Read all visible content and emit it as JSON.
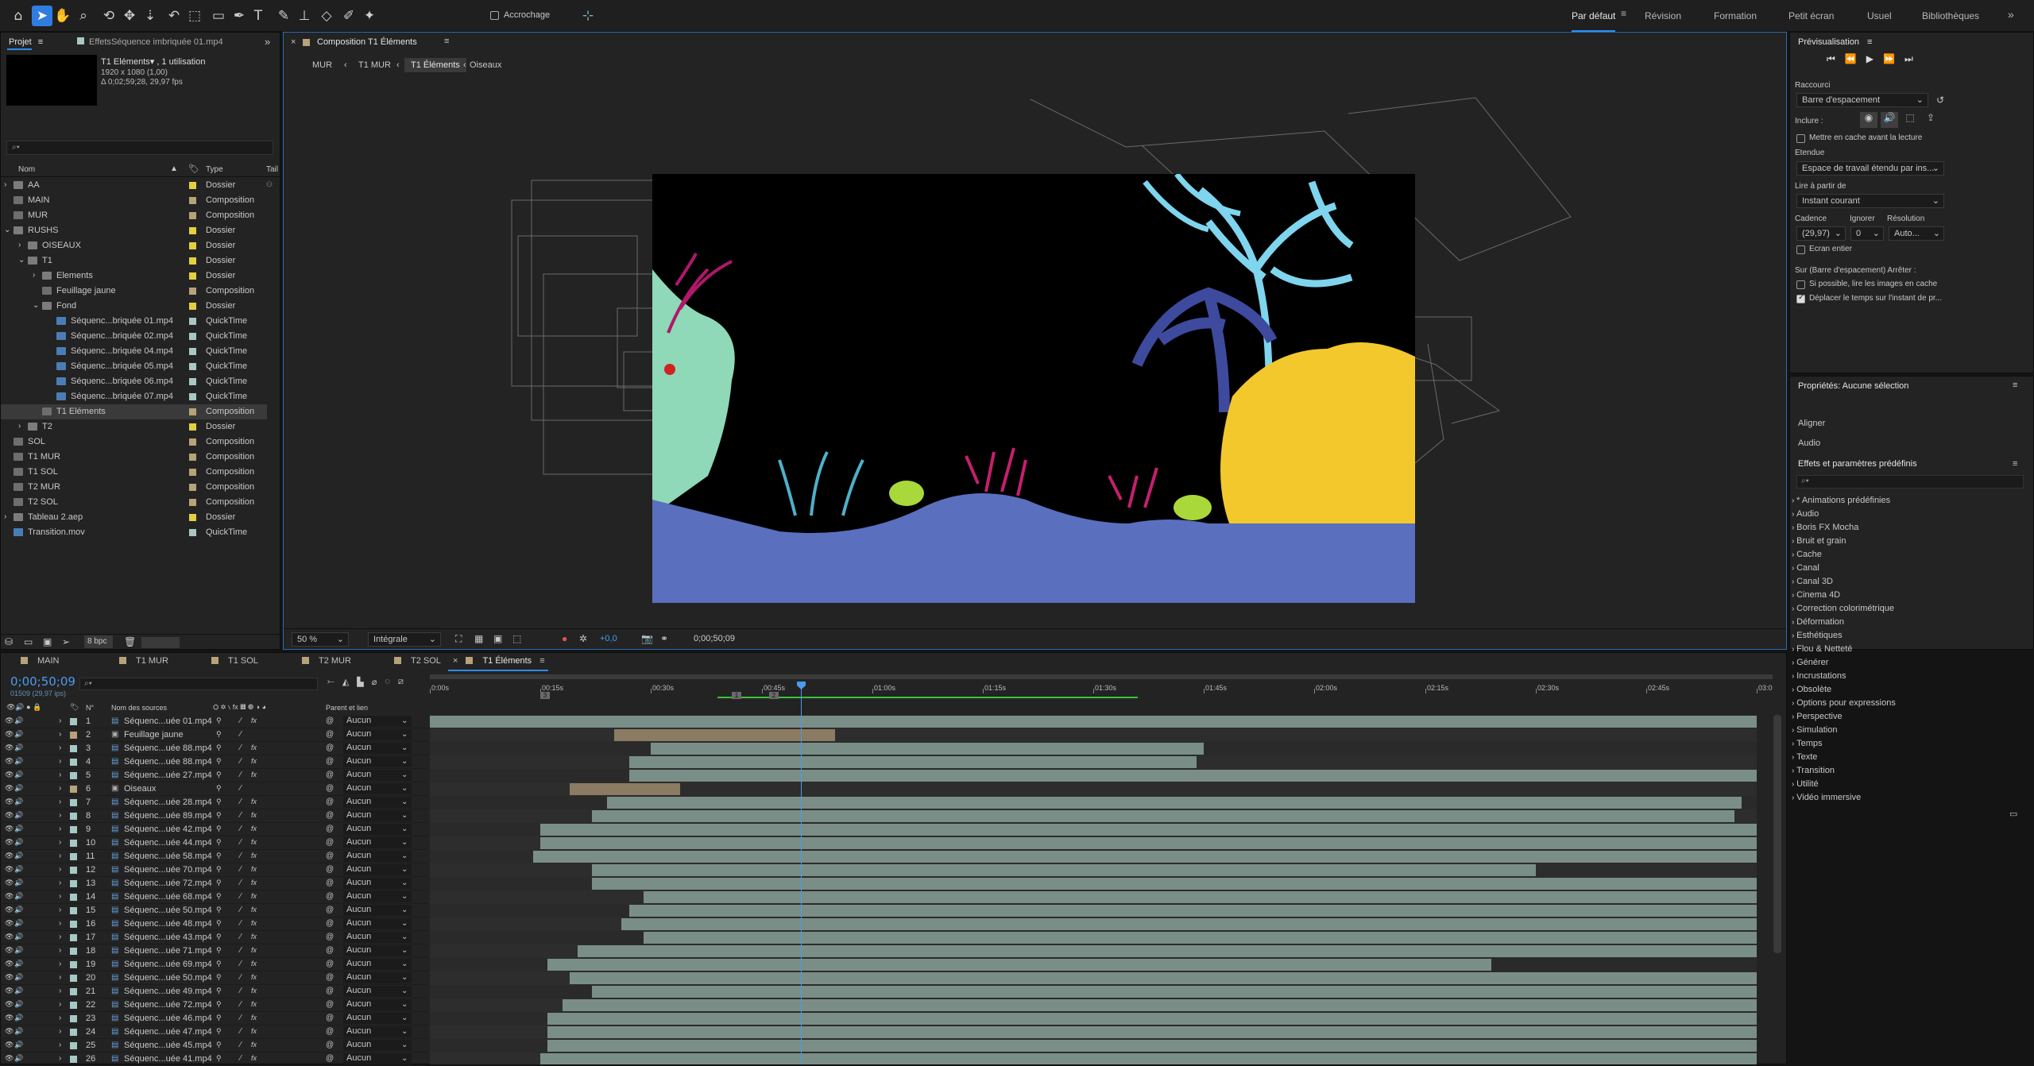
{
  "toolbar": {
    "tools": [
      {
        "name": "home-icon",
        "g": "⌂"
      },
      {
        "name": "selection-tool-icon",
        "g": "➤"
      },
      {
        "name": "hand-tool-icon",
        "g": "✋"
      },
      {
        "name": "zoom-tool-icon",
        "g": "⌕"
      },
      {
        "name": "orbit-camera-icon",
        "g": "⟲"
      },
      {
        "name": "pan-camera-icon",
        "g": "✥"
      },
      {
        "name": "dolly-camera-icon",
        "g": "⇣"
      },
      {
        "name": "rotation-tool-icon",
        "g": "↶"
      },
      {
        "name": "pan-behind-icon",
        "g": "⬚"
      },
      {
        "name": "rectangle-tool-icon",
        "g": "▭"
      },
      {
        "name": "pen-tool-icon",
        "g": "✒"
      },
      {
        "name": "type-tool-icon",
        "g": "T"
      },
      {
        "name": "brush-tool-icon",
        "g": "✎"
      },
      {
        "name": "clone-stamp-icon",
        "g": "⊥"
      },
      {
        "name": "eraser-tool-icon",
        "g": "◇"
      },
      {
        "name": "roto-brush-icon",
        "g": "✐"
      },
      {
        "name": "puppet-tool-icon",
        "g": "✦"
      }
    ],
    "snap_label": "Accrochage",
    "workspaces": [
      "Par défaut",
      "Révision",
      "Formation",
      "Petit écran",
      "Usuel",
      "Bibliothèques"
    ],
    "more": "»"
  },
  "project": {
    "tab": "Projet",
    "tab2_prefix": "Effets",
    "tab2": "Séquence imbriquée 01.mp4",
    "info_name": "T1 Eléments▾ , 1 utilisation",
    "info_res": "1920 x 1080 (1,00)",
    "info_dur": "Δ 0;02;59;28, 29,97 fps",
    "search_placeholder": "⌕▾",
    "col_name": "Nom",
    "col_type": "Type",
    "col_tail": "Tail",
    "rows": [
      {
        "n": "AA",
        "t": "Dossier",
        "c": "#e4cf3e",
        "k": "folder",
        "d": 0,
        "a": "›"
      },
      {
        "n": "MAIN",
        "t": "Composition",
        "c": "#b7a27a",
        "k": "comp",
        "d": 0,
        "a": ""
      },
      {
        "n": "MUR",
        "t": "Composition",
        "c": "#b7a27a",
        "k": "comp",
        "d": 0,
        "a": ""
      },
      {
        "n": "RUSHS",
        "t": "Dossier",
        "c": "#e4cf3e",
        "k": "folder",
        "d": 0,
        "a": "⌄"
      },
      {
        "n": "OISEAUX",
        "t": "Dossier",
        "c": "#e4cf3e",
        "k": "folder",
        "d": 1,
        "a": "›"
      },
      {
        "n": "T1",
        "t": "Dossier",
        "c": "#e4cf3e",
        "k": "folder",
        "d": 1,
        "a": "⌄"
      },
      {
        "n": "Elements",
        "t": "Dossier",
        "c": "#e4cf3e",
        "k": "folder",
        "d": 2,
        "a": "›"
      },
      {
        "n": "Feuillage jaune",
        "t": "Composition",
        "c": "#b7a27a",
        "k": "comp",
        "d": 2,
        "a": ""
      },
      {
        "n": "Fond",
        "t": "Dossier",
        "c": "#e4cf3e",
        "k": "folder",
        "d": 2,
        "a": "⌄"
      },
      {
        "n": "Séquenc...briquée 01.mp4",
        "t": "QuickTime",
        "c": "#a7c8c4",
        "k": "file",
        "d": 3,
        "a": ""
      },
      {
        "n": "Séquenc...briquée 02.mp4",
        "t": "QuickTime",
        "c": "#a7c8c4",
        "k": "file",
        "d": 3,
        "a": ""
      },
      {
        "n": "Séquenc...briquée 04.mp4",
        "t": "QuickTime",
        "c": "#a7c8c4",
        "k": "file",
        "d": 3,
        "a": ""
      },
      {
        "n": "Séquenc...briquée 05.mp4",
        "t": "QuickTime",
        "c": "#a7c8c4",
        "k": "file",
        "d": 3,
        "a": ""
      },
      {
        "n": "Séquenc...briquée 06.mp4",
        "t": "QuickTime",
        "c": "#a7c8c4",
        "k": "file",
        "d": 3,
        "a": ""
      },
      {
        "n": "Séquenc...briquée 07.mp4",
        "t": "QuickTime",
        "c": "#a7c8c4",
        "k": "file",
        "d": 3,
        "a": ""
      },
      {
        "n": "T1 Eléments",
        "t": "Composition",
        "c": "#b7a27a",
        "k": "comp",
        "d": 2,
        "a": "",
        "hl": true
      },
      {
        "n": "T2",
        "t": "Dossier",
        "c": "#e4cf3e",
        "k": "folder",
        "d": 1,
        "a": "›"
      },
      {
        "n": "SOL",
        "t": "Composition",
        "c": "#b7a27a",
        "k": "comp",
        "d": 0,
        "a": ""
      },
      {
        "n": "T1 MUR",
        "t": "Composition",
        "c": "#b7a27a",
        "k": "comp",
        "d": 0,
        "a": ""
      },
      {
        "n": "T1 SOL",
        "t": "Composition",
        "c": "#b7a27a",
        "k": "comp",
        "d": 0,
        "a": ""
      },
      {
        "n": "T2 MUR",
        "t": "Composition",
        "c": "#b7a27a",
        "k": "comp",
        "d": 0,
        "a": ""
      },
      {
        "n": "T2 SOL",
        "t": "Composition",
        "c": "#b7a27a",
        "k": "comp",
        "d": 0,
        "a": ""
      },
      {
        "n": "Tableau 2.aep",
        "t": "Dossier",
        "c": "#e4cf3e",
        "k": "folder",
        "d": 0,
        "a": "›"
      },
      {
        "n": "Transition.mov",
        "t": "QuickTime",
        "c": "#a7c8c4",
        "k": "file",
        "d": 0,
        "a": ""
      }
    ],
    "bpc": "8 bpc"
  },
  "viewer": {
    "tab": "Composition T1 Éléments",
    "breadcrumbs": [
      "MUR",
      "T1 MUR",
      "T1 Éléments",
      "Oiseaux"
    ],
    "zoom": "50 %",
    "resolution": "Intégrale",
    "exposure": "+0,0",
    "timecode": "0;00;50;09"
  },
  "timeline": {
    "tabs": [
      "MAIN",
      "T1 MUR",
      "T1 SOL",
      "T2 MUR",
      "T2 SOL",
      "T1 Éléments"
    ],
    "timecode": "0;00;50;09",
    "timecode_sub": "01509 (29,97 ips)",
    "search_placeholder": "⌕▾",
    "col_num": "N°",
    "col_source": "Nom des sources",
    "col_parent": "Parent et lien",
    "ruler": [
      "0:00s",
      "00:15s",
      "00:30s",
      "00:45s",
      "01:00s",
      "01:15s",
      "01:30s",
      "01:45s",
      "02:00s",
      "02:15s",
      "02:30s",
      "02:45s",
      "03:0"
    ],
    "playhead_sec": 50.3,
    "duration_sec": 180,
    "markers": [
      {
        "t": 15,
        "l": "3"
      },
      {
        "t": 41,
        "l": "1"
      },
      {
        "t": 46,
        "l": "2"
      }
    ],
    "work_area": [
      39,
      96
    ],
    "layers": [
      {
        "n": "1",
        "s": "Séquenc...uée 01.mp4",
        "p": "Aucun",
        "k": "file",
        "in": 0,
        "out": 180
      },
      {
        "n": "2",
        "s": "Feuillage jaune",
        "p": "Aucun",
        "k": "comp",
        "in": 25,
        "out": 55,
        "tan": true
      },
      {
        "n": "3",
        "s": "Séquenc...uée 88.mp4",
        "p": "Aucun",
        "k": "file",
        "in": 30,
        "out": 105
      },
      {
        "n": "4",
        "s": "Séquenc...uée 88.mp4",
        "p": "Aucun",
        "k": "file",
        "in": 27,
        "out": 104
      },
      {
        "n": "5",
        "s": "Séquenc...uée 27.mp4",
        "p": "Aucun",
        "k": "file",
        "in": 27,
        "out": 180
      },
      {
        "n": "6",
        "s": "Oiseaux",
        "p": "Aucun",
        "k": "comp",
        "in": 19,
        "out": 34,
        "tan": true
      },
      {
        "n": "7",
        "s": "Séquenc...uée 28.mp4",
        "p": "Aucun",
        "k": "file",
        "in": 24,
        "out": 178
      },
      {
        "n": "8",
        "s": "Séquenc...uée 89.mp4",
        "p": "Aucun",
        "k": "file",
        "in": 22,
        "out": 177
      },
      {
        "n": "9",
        "s": "Séquenc...uée 42.mp4",
        "p": "Aucun",
        "k": "file",
        "in": 15,
        "out": 180
      },
      {
        "n": "10",
        "s": "Séquenc...uée 44.mp4",
        "p": "Aucun",
        "k": "file",
        "in": 15,
        "out": 180
      },
      {
        "n": "11",
        "s": "Séquenc...uée 58.mp4",
        "p": "Aucun",
        "k": "file",
        "in": 14,
        "out": 180
      },
      {
        "n": "12",
        "s": "Séquenc...uée 70.mp4",
        "p": "Aucun",
        "k": "file",
        "in": 22,
        "out": 150
      },
      {
        "n": "13",
        "s": "Séquenc...uée 72.mp4",
        "p": "Aucun",
        "k": "file",
        "in": 22,
        "out": 180
      },
      {
        "n": "14",
        "s": "Séquenc...uée 68.mp4",
        "p": "Aucun",
        "k": "file",
        "in": 29,
        "out": 180
      },
      {
        "n": "15",
        "s": "Séquenc...uée 50.mp4",
        "p": "Aucun",
        "k": "file",
        "in": 27,
        "out": 180
      },
      {
        "n": "16",
        "s": "Séquenc...uée 48.mp4",
        "p": "Aucun",
        "k": "file",
        "in": 26,
        "out": 180
      },
      {
        "n": "17",
        "s": "Séquenc...uée 43.mp4",
        "p": "Aucun",
        "k": "file",
        "in": 29,
        "out": 180
      },
      {
        "n": "18",
        "s": "Séquenc...uée 71.mp4",
        "p": "Aucun",
        "k": "file",
        "in": 20,
        "out": 180
      },
      {
        "n": "19",
        "s": "Séquenc...uée 69.mp4",
        "p": "Aucun",
        "k": "file",
        "in": 16,
        "out": 144
      },
      {
        "n": "20",
        "s": "Séquenc...uée 50.mp4",
        "p": "Aucun",
        "k": "file",
        "in": 19,
        "out": 180
      },
      {
        "n": "21",
        "s": "Séquenc...uée 49.mp4",
        "p": "Aucun",
        "k": "file",
        "in": 22,
        "out": 180
      },
      {
        "n": "22",
        "s": "Séquenc...uée 72.mp4",
        "p": "Aucun",
        "k": "file",
        "in": 18,
        "out": 180
      },
      {
        "n": "23",
        "s": "Séquenc...uée 46.mp4",
        "p": "Aucun",
        "k": "file",
        "in": 16,
        "out": 180
      },
      {
        "n": "24",
        "s": "Séquenc...uée 47.mp4",
        "p": "Aucun",
        "k": "file",
        "in": 16,
        "out": 180
      },
      {
        "n": "25",
        "s": "Séquenc...uée 45.mp4",
        "p": "Aucun",
        "k": "file",
        "in": 16,
        "out": 180
      },
      {
        "n": "26",
        "s": "Séquenc...uée 41.mp4",
        "p": "Aucun",
        "k": "file",
        "in": 15,
        "out": 180
      }
    ]
  },
  "preview": {
    "title": "Prévisualisation",
    "raccourci_label": "Raccourci",
    "raccourci": "Barre d'espacement",
    "inclure_label": "Inclure :",
    "cache_label": "Mettre en cache avant la lecture",
    "etendue_label": "Etendue",
    "etendue": "Espace de travail étendu par ins...",
    "lire_label": "Lire à partir de",
    "lire": "Instant courant",
    "cadence_label": "Cadence",
    "ignorer_label": "Ignorer",
    "resolution_label": "Résolution",
    "cadence": "(29,97)",
    "ignorer": "0",
    "resolution": "Auto...",
    "ecran_label": "Ecran entier",
    "stop_label": "Sur (Barre d'espacement) Arrêter :",
    "opt1": "Si possible, lire les images en cache",
    "opt2": "Déplacer le temps sur l'instant de pr..."
  },
  "properties": {
    "title": "Propriétés: Aucune sélection",
    "aligner": "Aligner",
    "audio": "Audio"
  },
  "effects": {
    "title": "Effets et paramètres prédéfinis",
    "search_placeholder": "⌕▾",
    "items": [
      "* Animations prédéfinies",
      "Audio",
      "Boris FX Mocha",
      "Bruit et grain",
      "Cache",
      "Canal",
      "Canal 3D",
      "Cinema 4D",
      "Correction colorimétrique",
      "Déformation",
      "Esthétiques",
      "Flou & Netteté",
      "Générer",
      "Incrustations",
      "Obsolète",
      "Options pour expressions",
      "Perspective",
      "Simulation",
      "Temps",
      "Texte",
      "Transition",
      "Utilité",
      "Vidéo immersive"
    ]
  },
  "colors": {
    "accent": "#2d8ceb",
    "playhead": "#4a9cf0",
    "bar": "#7a8e88",
    "bar_tan": "#8a7b62",
    "folder": "#e4cf3e",
    "comp": "#b7a27a",
    "file": "#a7c8c4",
    "workarea": "#38c43a"
  }
}
